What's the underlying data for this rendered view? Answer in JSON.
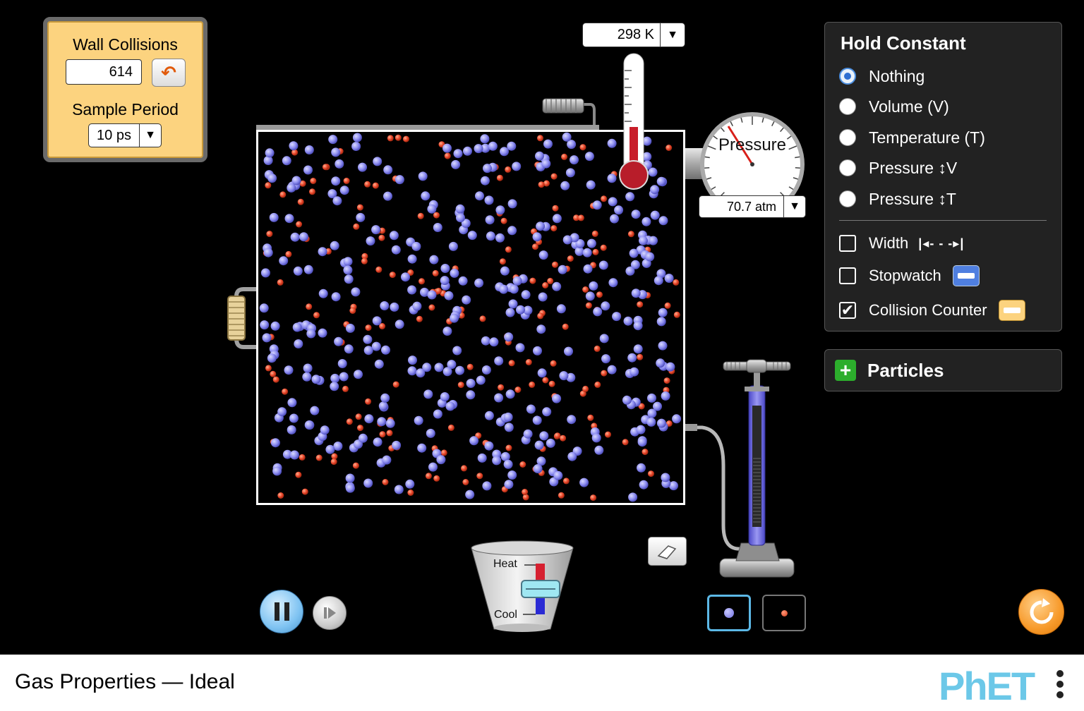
{
  "collision_counter": {
    "title": "Wall Collisions",
    "count": "614",
    "sample_label": "Sample Period",
    "sample_value": "10 ps"
  },
  "thermometer": {
    "reading": "298 K"
  },
  "pressure_gauge": {
    "label": "Pressure",
    "reading": "70.7 atm"
  },
  "hold_constant": {
    "title": "Hold Constant",
    "options": [
      "Nothing",
      "Volume (V)",
      "Temperature (T)",
      "Pressure ↕V",
      "Pressure ↕T"
    ],
    "selected": "Nothing"
  },
  "tools": {
    "width_label": "Width",
    "stopwatch_label": "Stopwatch",
    "collision_counter_label": "Collision Counter",
    "width_checked": false,
    "stopwatch_checked": false,
    "collision_counter_checked": true
  },
  "particles_panel": {
    "title": "Particles"
  },
  "heater": {
    "heat_label": "Heat",
    "cool_label": "Cool"
  },
  "particle_colors": {
    "heavy": "#8e8ef0",
    "light": "#e8452a"
  },
  "particle_counts": {
    "heavy": 380,
    "light": 200
  },
  "nav": {
    "title": "Gas Properties — Ideal",
    "logo": "PhET"
  }
}
